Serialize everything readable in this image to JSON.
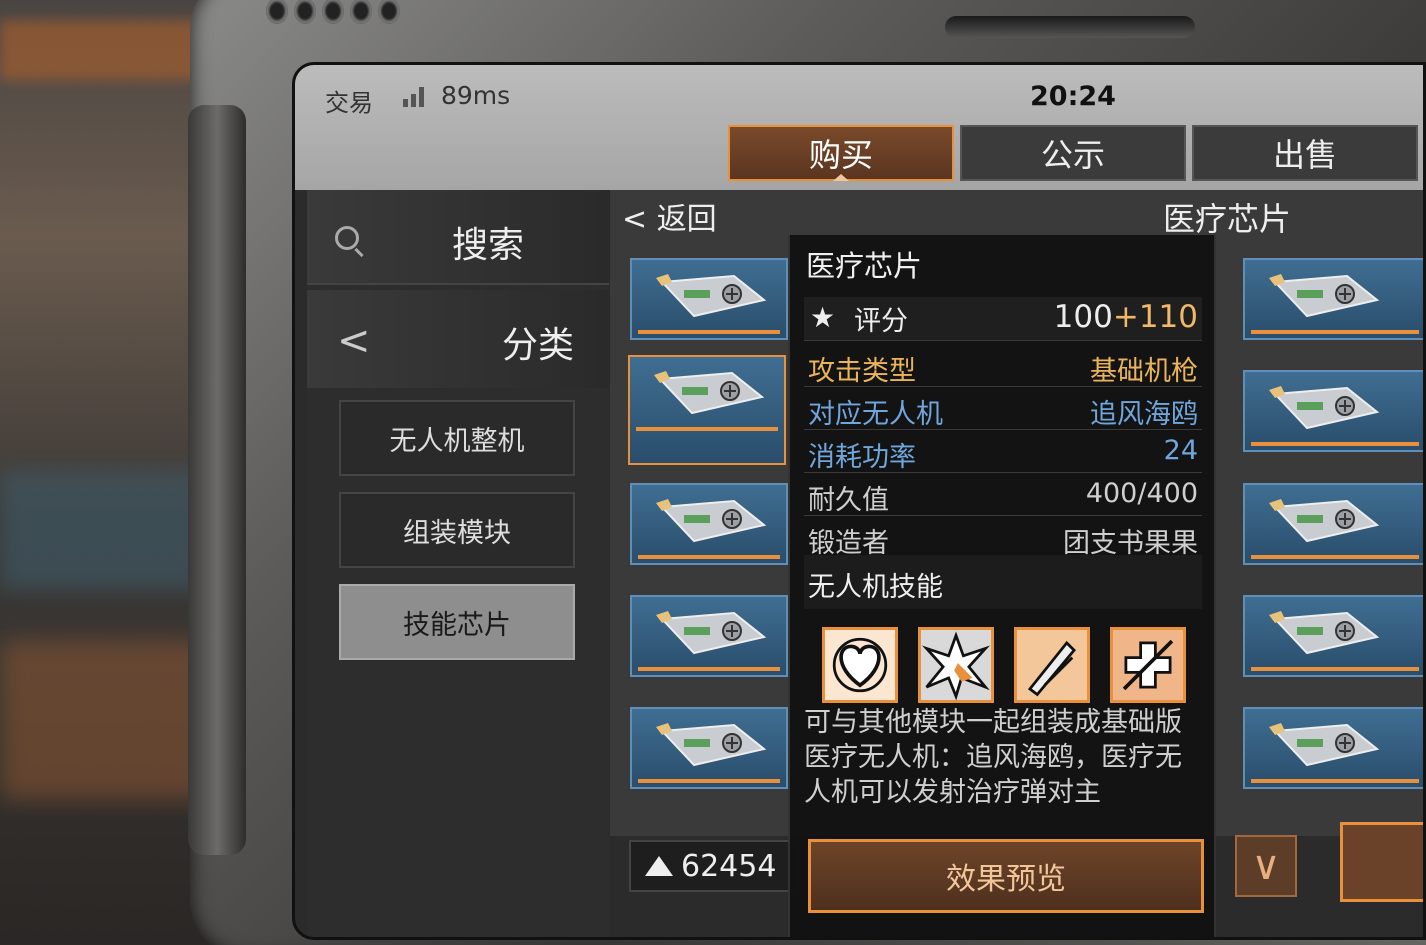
{
  "status": {
    "app": "交易",
    "ping": "89ms",
    "time": "20:24"
  },
  "tabs": [
    {
      "label": "购买",
      "active": true
    },
    {
      "label": "公示",
      "active": false
    },
    {
      "label": "出售",
      "active": false
    }
  ],
  "sidebar": {
    "search_label": "搜索",
    "category_label": "分类",
    "items": [
      {
        "label": "无人机整机",
        "active": false
      },
      {
        "label": "组装模块",
        "active": false
      },
      {
        "label": "技能芯片",
        "active": true
      }
    ]
  },
  "main": {
    "back_label": "返回",
    "category_title": "医疗芯片",
    "currency": "62454"
  },
  "detail": {
    "title": "医疗芯片",
    "score_label": "评分",
    "score_base": "100",
    "score_bonus": "+110",
    "rows": [
      {
        "key": "攻击类型",
        "value": "基础机枪"
      },
      {
        "key": "对应无人机",
        "value": "追风海鸥"
      },
      {
        "key": "消耗功率",
        "value": "24"
      },
      {
        "key": "耐久值",
        "value": "400/400"
      },
      {
        "key": "锻造者",
        "value": "团支书果果"
      }
    ],
    "skills_title": "无人机技能",
    "skill_icons": [
      "heart-shield-icon",
      "explosion-icon",
      "missile-icon",
      "medical-syringe-icon"
    ],
    "description": "可与其他模块一起组装成基础版医疗无人机：追风海鸥，医疗无人机可以发射治疗弹对主",
    "preview_button": "效果预览"
  },
  "colors": {
    "accent": "#e8903c",
    "card_blue": "#3f6e92",
    "label_yellow": "#eab55a",
    "label_blue": "#6fa6dc"
  }
}
